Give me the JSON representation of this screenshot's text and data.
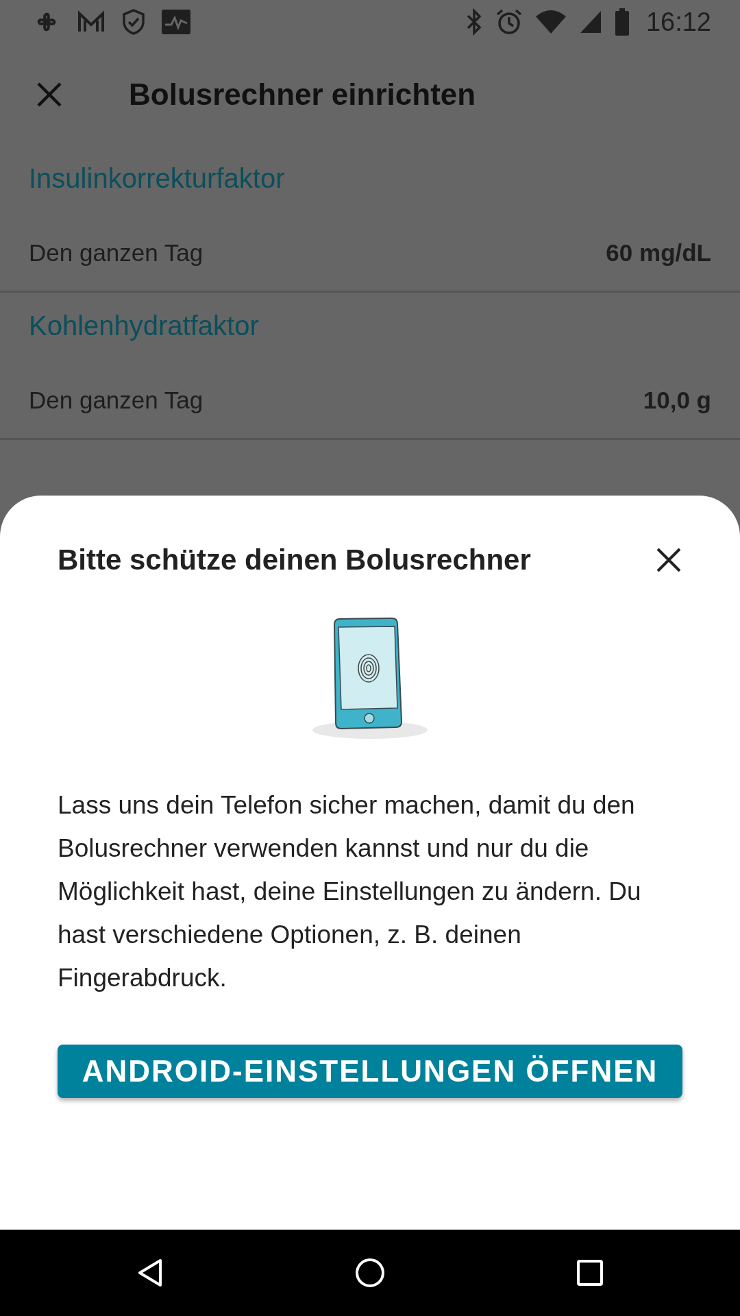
{
  "status_bar": {
    "time": "16:12"
  },
  "app_bar": {
    "title": "Bolusrechner einrichten"
  },
  "sections": [
    {
      "heading": "Insulinkorrekturfaktor",
      "rows": [
        {
          "label": "Den ganzen Tag",
          "value": "60 mg/dL"
        }
      ]
    },
    {
      "heading": "Kohlenhydratfaktor",
      "rows": [
        {
          "label": "Den ganzen Tag",
          "value": "10,0 g"
        }
      ]
    }
  ],
  "sheet": {
    "title": "Bitte schütze deinen Bolusrechner",
    "body": "Lass uns dein Telefon sicher machen, damit du den Bolusrechner verwenden kannst und nur du die Möglichkeit hast, deine Einstellungen zu ändern. Du hast verschiedene Optionen, z. B. deinen Fingerabdruck.",
    "button": "ANDROID-EINSTELLUNGEN ÖFFNEN"
  }
}
